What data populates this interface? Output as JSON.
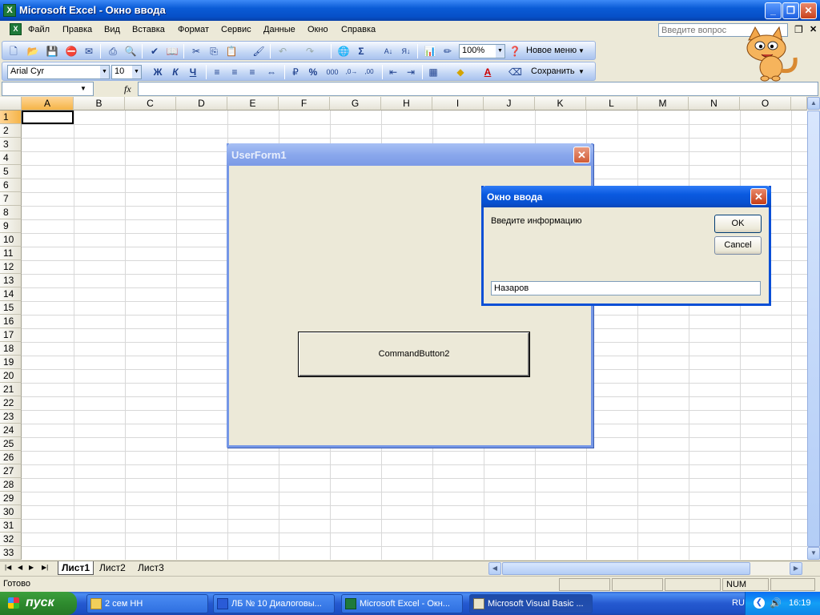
{
  "window": {
    "title": "Microsoft Excel - Окно ввода",
    "icon": "excel-icon"
  },
  "menu": {
    "items": [
      "Файл",
      "Правка",
      "Вид",
      "Вставка",
      "Формат",
      "Сервис",
      "Данные",
      "Окно",
      "Справка"
    ],
    "ask_placeholder": "Введите вопрос"
  },
  "toolbar_standard": {
    "zoom": "100%",
    "new_menu": "Новое меню"
  },
  "toolbar_formatting": {
    "font": "Arial Cyr",
    "size": "10",
    "bold": "Ж",
    "italic": "К",
    "underline": "Ч",
    "save_label": "Сохранить"
  },
  "formula_bar": {
    "fx": "fx",
    "name_box": "",
    "formula": ""
  },
  "grid": {
    "columns": [
      "A",
      "B",
      "C",
      "D",
      "E",
      "F",
      "G",
      "H",
      "I",
      "J",
      "K",
      "L",
      "M",
      "N",
      "O"
    ],
    "rows": [
      "1",
      "2",
      "3",
      "4",
      "5",
      "6",
      "7",
      "8",
      "9",
      "10",
      "11",
      "12",
      "13",
      "14",
      "15",
      "16",
      "17",
      "18",
      "19",
      "20",
      "21",
      "22",
      "23",
      "24",
      "25",
      "26",
      "27",
      "28",
      "29",
      "30",
      "31",
      "32",
      "33"
    ],
    "active_col": "A",
    "active_row": "1"
  },
  "sheets": {
    "tabs": [
      "Лист1",
      "Лист2",
      "Лист3"
    ],
    "active": "Лист1"
  },
  "status": {
    "ready": "Готово",
    "num": "NUM"
  },
  "userform": {
    "title": "UserForm1",
    "button": "CommandButton2"
  },
  "inputbox": {
    "title": "Окно ввода",
    "prompt": "Введите информацию",
    "ok": "OK",
    "cancel": "Cancel",
    "value": "Назаров"
  },
  "taskbar": {
    "start": "пуск",
    "tasks": [
      {
        "label": "2 сем НН",
        "icon": "folder-icon"
      },
      {
        "label": "ЛБ № 10 Диалоговы...",
        "icon": "word-icon"
      },
      {
        "label": "Microsoft Excel - Окн...",
        "icon": "excel-icon"
      },
      {
        "label": "Microsoft Visual Basic ...",
        "icon": "vba-icon"
      }
    ],
    "lang": "RU",
    "clock": "16:19"
  }
}
